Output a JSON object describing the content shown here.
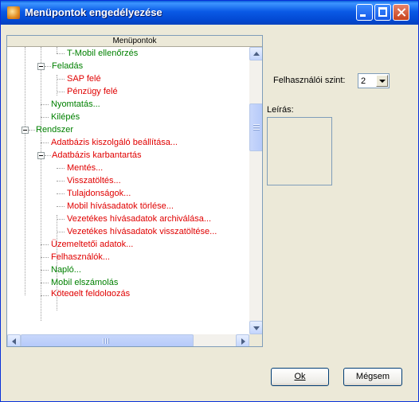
{
  "window": {
    "title": "Menüpontok engedélyezése"
  },
  "tree": {
    "header": "Menüpontok",
    "items": [
      {
        "label": "T-Mobil ellenőrzés",
        "color": "green"
      },
      {
        "label": "Feladás",
        "color": "green"
      },
      {
        "label": "SAP felé",
        "color": "red"
      },
      {
        "label": "Pénzügy felé",
        "color": "red"
      },
      {
        "label": "Nyomtatás...",
        "color": "green"
      },
      {
        "label": "Kilépés",
        "color": "green"
      },
      {
        "label": "Rendszer",
        "color": "green"
      },
      {
        "label": "Adatbázis kiszolgáló beállítása...",
        "color": "red"
      },
      {
        "label": "Adatbázis karbantartás",
        "color": "red"
      },
      {
        "label": "Mentés...",
        "color": "red"
      },
      {
        "label": "Visszatöltés...",
        "color": "red"
      },
      {
        "label": "Tulajdonságok...",
        "color": "red"
      },
      {
        "label": "Mobil hívásadatok törlése...",
        "color": "red"
      },
      {
        "label": "Vezetékes hívásadatok archiválása...",
        "color": "red"
      },
      {
        "label": "Vezetékes hívásadatok visszatöltése...",
        "color": "red"
      },
      {
        "label": "Üzemeltetői adatok...",
        "color": "red"
      },
      {
        "label": "Felhasználók...",
        "color": "red"
      },
      {
        "label": "Napló...",
        "color": "green"
      },
      {
        "label": "Mobil elszámolás",
        "color": "green"
      },
      {
        "label": "Kötegelt feldolgozás",
        "color": "red"
      }
    ]
  },
  "user_level": {
    "label": "Felhasználói szint:",
    "value": "2"
  },
  "description": {
    "label": "Leírás:"
  },
  "buttons": {
    "ok": "Ok",
    "cancel": "Mégsem"
  },
  "colors": {
    "red": "#e00000",
    "green": "#008000",
    "titlebar": "#0a5ae6"
  }
}
